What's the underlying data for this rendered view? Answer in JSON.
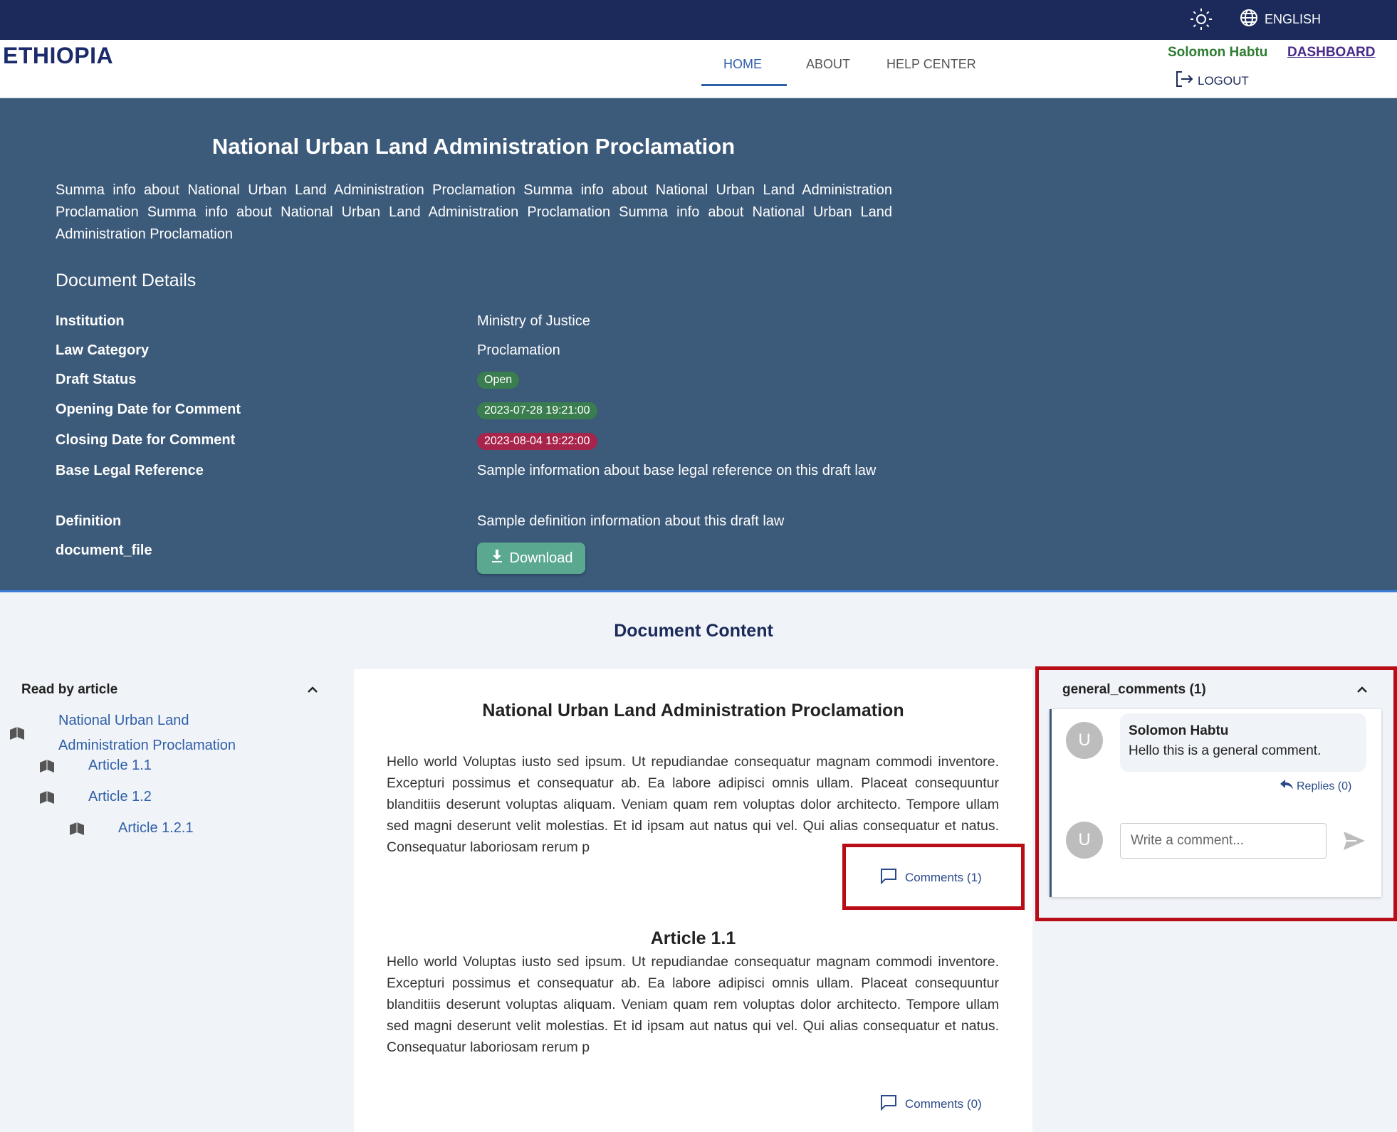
{
  "header": {
    "language": "ENGLISH",
    "brand": "ETHIOPIA",
    "nav": {
      "home": "HOME",
      "about": "ABOUT",
      "help": "HELP CENTER"
    },
    "user_name": "Solomon Habtu",
    "dashboard": "DASHBOARD",
    "logout": "LOGOUT",
    "icons": {
      "theme": "sun-icon",
      "language": "globe-icon",
      "logout": "logout-icon"
    }
  },
  "hero": {
    "title": "National Urban Land Administration Proclamation",
    "summary": "Summa info about National Urban Land Administration Proclamation Summa info about National Urban Land Administration Proclamation Summa info about National Urban Land Administration Proclamation Summa info about National Urban Land Administration Proclamation",
    "details_title": "Document Details",
    "details": {
      "institution": {
        "label": "Institution",
        "value": "Ministry of Justice"
      },
      "law_category": {
        "label": "Law Category",
        "value": "Proclamation"
      },
      "draft_status": {
        "label": "Draft Status",
        "value": "Open"
      },
      "opening_date": {
        "label": "Opening Date for Comment",
        "value": "2023-07-28 19:21:00"
      },
      "closing_date": {
        "label": "Closing Date for Comment",
        "value": "2023-08-04 19:22:00"
      },
      "base_legal_reference": {
        "label": "Base Legal Reference",
        "value": "Sample information about base legal reference on this draft law"
      },
      "definition": {
        "label": "Definition",
        "value": "Sample definition information about this draft law"
      },
      "document_file": {
        "label": "document_file",
        "button": "Download"
      }
    },
    "colors": {
      "open": "#3a7d4f",
      "closing": "#a8244b",
      "download": "#5aa890",
      "background": "#3c5a7a"
    }
  },
  "content": {
    "title": "Document Content",
    "toc": {
      "header": "Read by article",
      "items": [
        {
          "line1": "National Urban Land",
          "line2": "Administration Proclamation"
        },
        {
          "label": "Article 1.1"
        },
        {
          "label": "Article 1.2"
        },
        {
          "label": "Article 1.2.1"
        }
      ]
    },
    "document": {
      "title": "National Urban Land Administration Proclamation",
      "intro_text": "Hello world Voluptas iusto sed ipsum. Ut repudiandae consequatur magnam commodi inventore. Excepturi possimus et consequatur ab. Ea labore adipisci omnis ullam. Placeat consequuntur blanditiis deserunt voluptas aliquam. Veniam quam rem voluptas dolor architecto. Tempore ullam sed magni deserunt velit molestias. Et id ipsam aut natus qui vel. Qui alias consequatur et natus. Consequatur laboriosam rerum p",
      "intro_comments": "Comments (1)",
      "article_title": "Article 1.1",
      "article_text": "Hello world Voluptas iusto sed ipsum. Ut repudiandae consequatur magnam commodi inventore. Excepturi possimus et consequatur ab. Ea labore adipisci omnis ullam. Placeat consequuntur blanditiis deserunt voluptas aliquam. Veniam quam rem voluptas dolor architecto. Tempore ullam sed magni deserunt velit molestias. Et id ipsam aut natus qui vel. Qui alias consequatur et natus. Consequatur laboriosam rerum p",
      "article_comments": "Comments (0)"
    },
    "general_comments": {
      "title": "general_comments (1)",
      "comment": {
        "avatar": "U",
        "author": "Solomon Habtu",
        "text": "Hello this is a general comment.",
        "replies": "Replies (0)"
      },
      "input": {
        "avatar": "U",
        "placeholder": "Write a comment..."
      }
    },
    "highlight_color": "#b80d17"
  }
}
